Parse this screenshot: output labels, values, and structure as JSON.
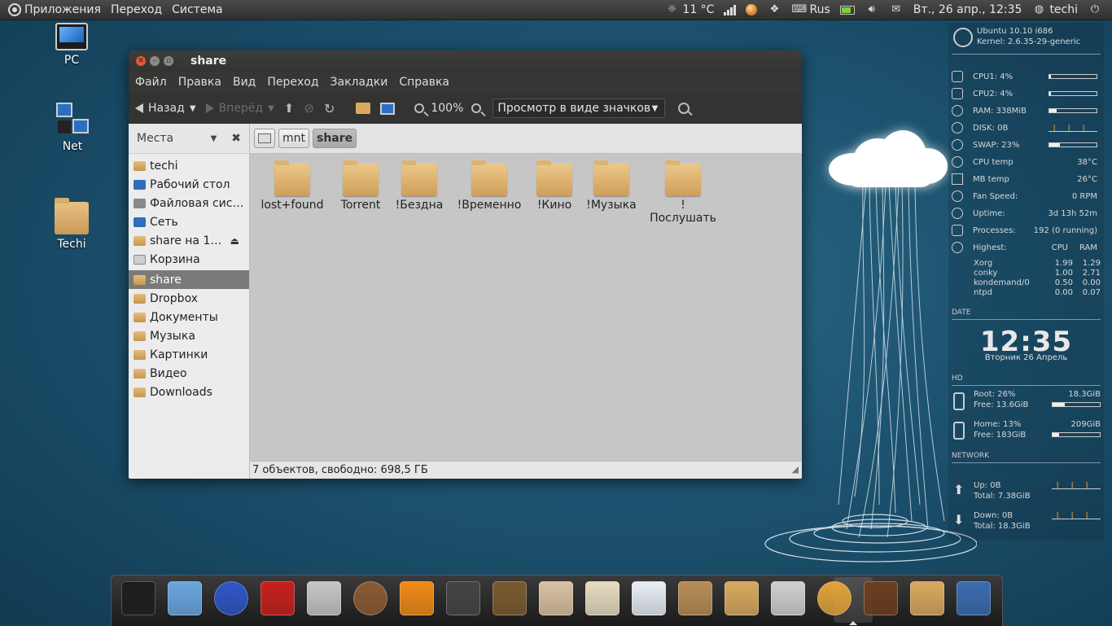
{
  "panel": {
    "menus": [
      "Приложения",
      "Переход",
      "Система"
    ],
    "weather": "11 °C",
    "keyboard": "Rus",
    "datetime": "Вт., 26 апр., 12:35",
    "user": "techi"
  },
  "desktop": {
    "icons": [
      {
        "label": "PC"
      },
      {
        "label": "Net"
      },
      {
        "label": "Techi"
      }
    ]
  },
  "window": {
    "title": "share",
    "menu": [
      "Файл",
      "Правка",
      "Вид",
      "Переход",
      "Закладки",
      "Справка"
    ],
    "toolbar": {
      "back": "Назад",
      "forward": "Вперёд",
      "zoom": "100%",
      "view_mode": "Просмотр в виде значков"
    },
    "sidebar": {
      "title": "Места",
      "items": [
        {
          "label": "techi",
          "icon": "home-folder-icon"
        },
        {
          "label": "Рабочий стол",
          "icon": "desktop-icon"
        },
        {
          "label": "Файловая сис…",
          "icon": "drive-icon"
        },
        {
          "label": "Сеть",
          "icon": "network-icon"
        },
        {
          "label": "share на 1…",
          "icon": "network-share-icon"
        },
        {
          "label": "Корзина",
          "icon": "trash-icon"
        },
        {
          "label": "share",
          "icon": "folder-icon"
        },
        {
          "label": "Dropbox",
          "icon": "folder-icon"
        },
        {
          "label": "Документы",
          "icon": "documents-folder-icon"
        },
        {
          "label": "Музыка",
          "icon": "music-folder-icon"
        },
        {
          "label": "Картинки",
          "icon": "pictures-folder-icon"
        },
        {
          "label": "Видео",
          "icon": "videos-folder-icon"
        },
        {
          "label": "Downloads",
          "icon": "folder-icon"
        }
      ],
      "selected": "share"
    },
    "path": [
      "mnt",
      "share"
    ],
    "files": [
      {
        "name": "lost+found"
      },
      {
        "name": "Torrent"
      },
      {
        "name": "!Бездна"
      },
      {
        "name": "!Временно"
      },
      {
        "name": "!Кино"
      },
      {
        "name": "!Музыка"
      },
      {
        "name": "!",
        "name2": "Послушать"
      }
    ],
    "status": "7 объектов, свободно: 698,5 ГБ"
  },
  "conky": {
    "os": "Ubuntu 10.10 i686",
    "kernel": "Kernel: 2.6.35-29-generic",
    "rows": [
      {
        "label": "CPU1: 4%",
        "bar": 0.04
      },
      {
        "label": "CPU2: 4%",
        "bar": 0.04
      },
      {
        "label": "RAM: 338MiB",
        "bar": 0.15
      },
      {
        "label": "DISK: 0B"
      },
      {
        "label": "SWAP: 23%",
        "bar": 0.23
      },
      {
        "label": "CPU temp",
        "value": "38°C"
      },
      {
        "label": "MB temp",
        "value": "26°C"
      },
      {
        "label": "Fan Speed:",
        "value": "0 RPM"
      },
      {
        "label": "Uptime:",
        "value": "3d 13h 52m"
      },
      {
        "label": "Processes:",
        "value": "192 (0 running)"
      }
    ],
    "highest": {
      "label": "Highest:",
      "col_cpu": "CPU",
      "col_ram": "RAM",
      "procs": [
        {
          "name": "Xorg",
          "cpu": "1.99",
          "ram": "1.29"
        },
        {
          "name": "conky",
          "cpu": "1.00",
          "ram": "2.71"
        },
        {
          "name": "kondemand/0",
          "cpu": "0.50",
          "ram": "0.00"
        },
        {
          "name": "ntpd",
          "cpu": "0.00",
          "ram": "0.07"
        }
      ]
    },
    "date_title": "DATE",
    "time": "12:35",
    "date": "Вторник 26 Апрель",
    "hd_title": "HD",
    "root": {
      "line1": "Root: 26%",
      "line2": "Free: 13.6GiB",
      "size": "18.3GiB",
      "bar": 0.26
    },
    "home": {
      "line1": "Home: 13%",
      "line2": "Free: 183GiB",
      "size": "209GiB",
      "bar": 0.13
    },
    "net_title": "NETWORK",
    "up": {
      "line1": "Up: 0B",
      "line2": "Total: 7.38GiB"
    },
    "down": {
      "line1": "Down: 0B",
      "line2": "Total: 18.3GiB"
    }
  },
  "dock": {
    "items": [
      {
        "name": "terminal-icon",
        "color": "#1d1d1d"
      },
      {
        "name": "chromium-icon",
        "color": "#6aa6e0"
      },
      {
        "name": "browser-globe-icon",
        "color": "#2e55c8"
      },
      {
        "name": "filezilla-icon",
        "color": "#c8201c"
      },
      {
        "name": "package-installer-icon",
        "color": "#c6c6c6"
      },
      {
        "name": "speaker-icon",
        "color": "#8a5a33"
      },
      {
        "name": "vlc-icon",
        "color": "#f08a17"
      },
      {
        "name": "video-player-icon",
        "color": "#444444"
      },
      {
        "name": "mona-lisa-image-viewer-icon",
        "color": "#7a5a2e"
      },
      {
        "name": "paint-icon",
        "color": "#d9c2a2"
      },
      {
        "name": "mail-letter-icon",
        "color": "#e8dcc0"
      },
      {
        "name": "chat-bubble-icon",
        "color": "#e8eef5"
      },
      {
        "name": "archive-box-icon",
        "color": "#b88d55"
      },
      {
        "name": "home-folder-icon",
        "color": "#d9a95e"
      },
      {
        "name": "workspace-switcher-icon",
        "color": "#d0d0d0"
      },
      {
        "name": "safari-compass-icon",
        "color": "#e2a23a"
      },
      {
        "name": "moose-mascot-icon",
        "color": "#6b3e1e"
      },
      {
        "name": "folder-icon",
        "color": "#d9a95e"
      },
      {
        "name": "desktop-monitor-icon",
        "color": "#3a6cb0"
      }
    ]
  }
}
